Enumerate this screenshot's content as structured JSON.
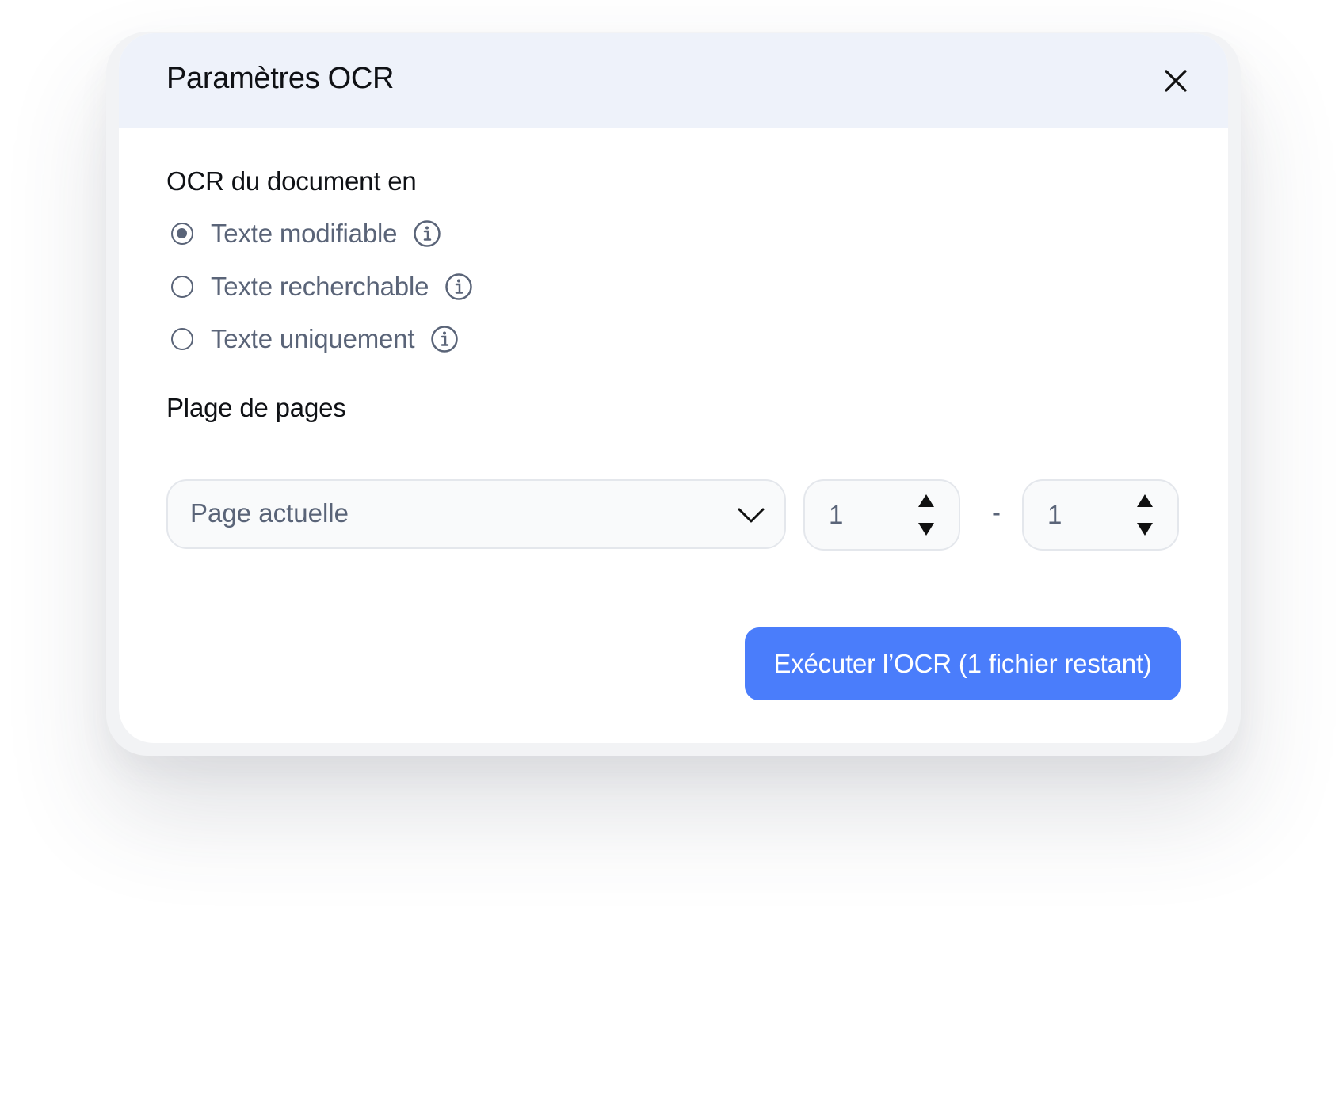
{
  "dialog": {
    "title": "Paramètres OCR",
    "close_icon": "close-icon"
  },
  "ocr_mode": {
    "label": "OCR du document en",
    "options": [
      {
        "label": "Texte modifiable",
        "selected": true,
        "icon": "info-icon"
      },
      {
        "label": "Texte recherchable",
        "selected": false,
        "icon": "info-icon"
      },
      {
        "label": "Texte uniquement",
        "selected": false,
        "icon": "info-icon"
      }
    ]
  },
  "page_range": {
    "label": "Plage de pages",
    "select_value": "Page actuelle",
    "select_icon": "chevron-down-icon",
    "from": "1",
    "separator": "-",
    "to": "1"
  },
  "actions": {
    "run_label": "Exécuter l’OCR (1 fichier restant)"
  },
  "colors": {
    "accent": "#4a7dfb",
    "header_bg": "#eef2fa",
    "muted_text": "#5a6478"
  }
}
